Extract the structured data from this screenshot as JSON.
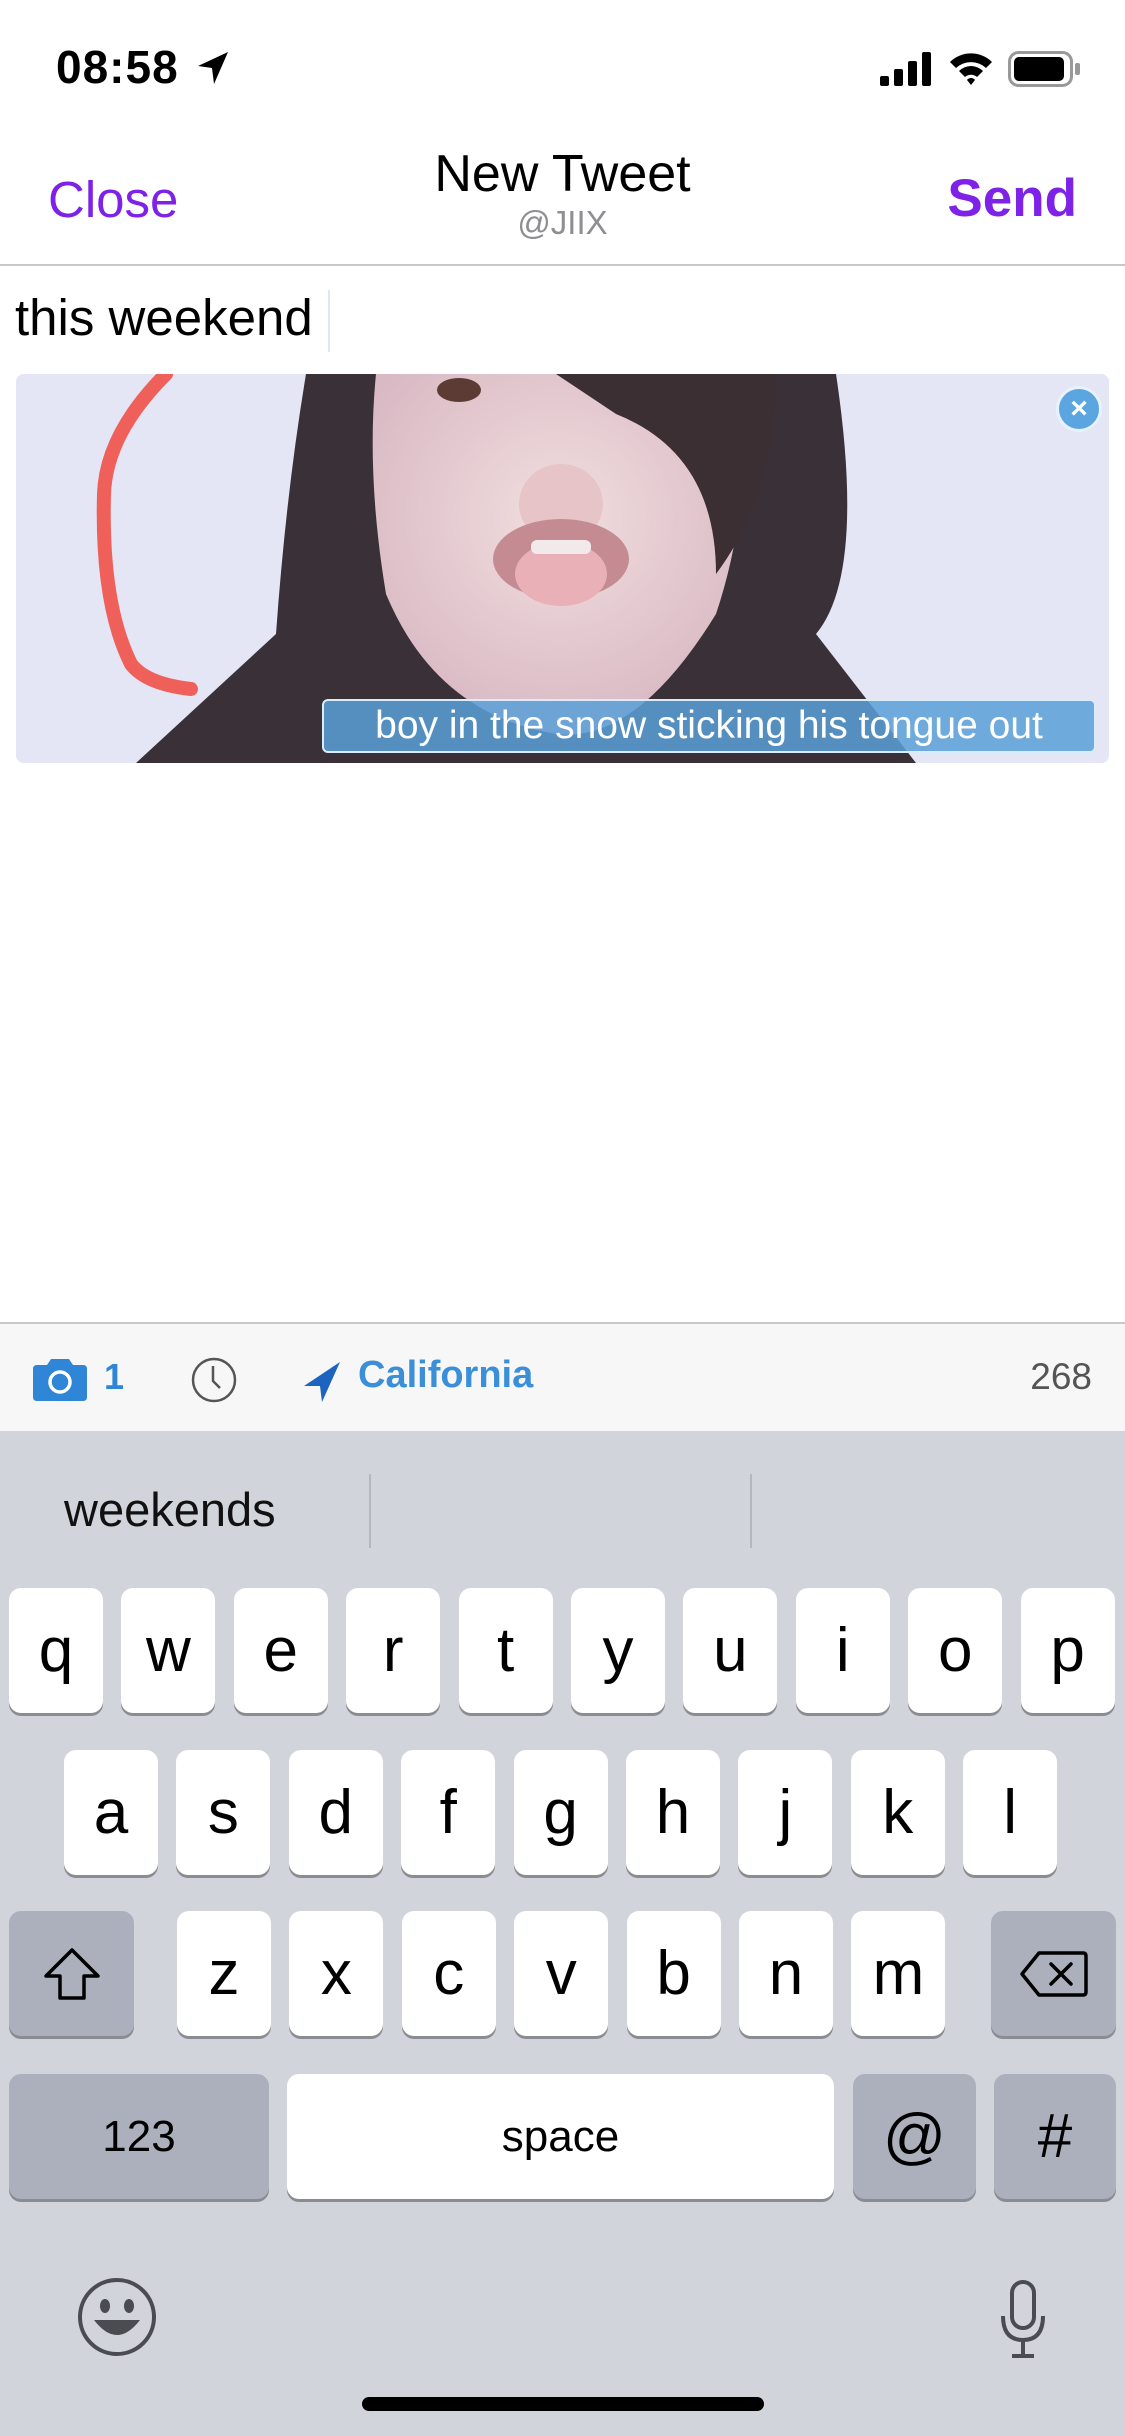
{
  "status_bar": {
    "time": "08:58",
    "icons": [
      "location-arrow-icon",
      "signal-icon",
      "wifi-icon",
      "battery-icon"
    ]
  },
  "nav": {
    "close_label": "Close",
    "title": "New Tweet",
    "subtitle": "@JIIX",
    "send_label": "Send",
    "accent": "#7d22e6"
  },
  "compose": {
    "text": "this weekend"
  },
  "attachment": {
    "alt_text": "boy in the snow sticking his tongue out",
    "remove_icon": "close-circle-icon"
  },
  "toolbar": {
    "photo_count": "1",
    "location": "California",
    "chars_remaining": "268",
    "accent": "#2f86d6"
  },
  "keyboard": {
    "suggestions": [
      "weekends",
      "",
      ""
    ],
    "rows": [
      [
        "q",
        "w",
        "e",
        "r",
        "t",
        "y",
        "u",
        "i",
        "o",
        "p"
      ],
      [
        "a",
        "s",
        "d",
        "f",
        "g",
        "h",
        "j",
        "k",
        "l"
      ],
      [
        "z",
        "x",
        "c",
        "v",
        "b",
        "n",
        "m"
      ]
    ],
    "numbers_label": "123",
    "space_label": "space",
    "at_label": "@",
    "hash_label": "#"
  }
}
